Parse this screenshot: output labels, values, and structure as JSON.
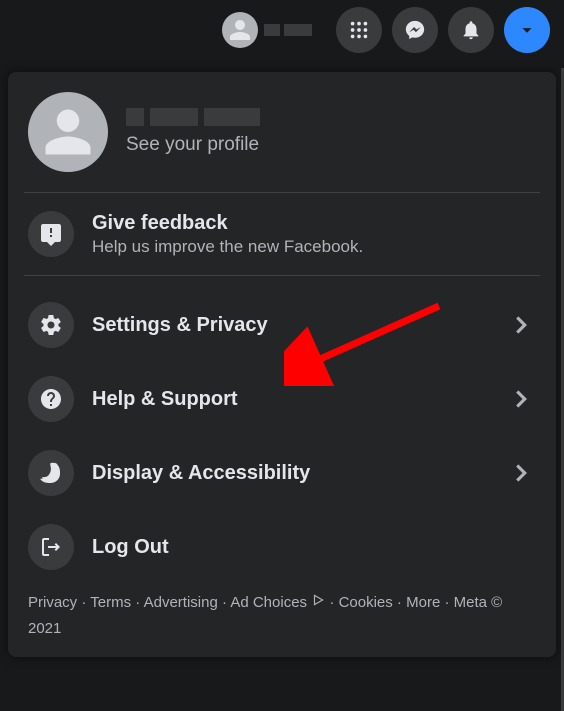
{
  "topbar": {
    "profile_name_redacted": true
  },
  "profile": {
    "see_profile": "See your profile"
  },
  "feedback": {
    "title": "Give feedback",
    "subtitle": "Help us improve the new Facebook."
  },
  "menu": {
    "settings": "Settings & Privacy",
    "help": "Help & Support",
    "display": "Display & Accessibility",
    "logout": "Log Out"
  },
  "footer": {
    "privacy": "Privacy",
    "terms": "Terms",
    "advertising": "Advertising",
    "adchoices": "Ad Choices",
    "cookies": "Cookies",
    "more": "More",
    "meta": "Meta © 2021"
  }
}
